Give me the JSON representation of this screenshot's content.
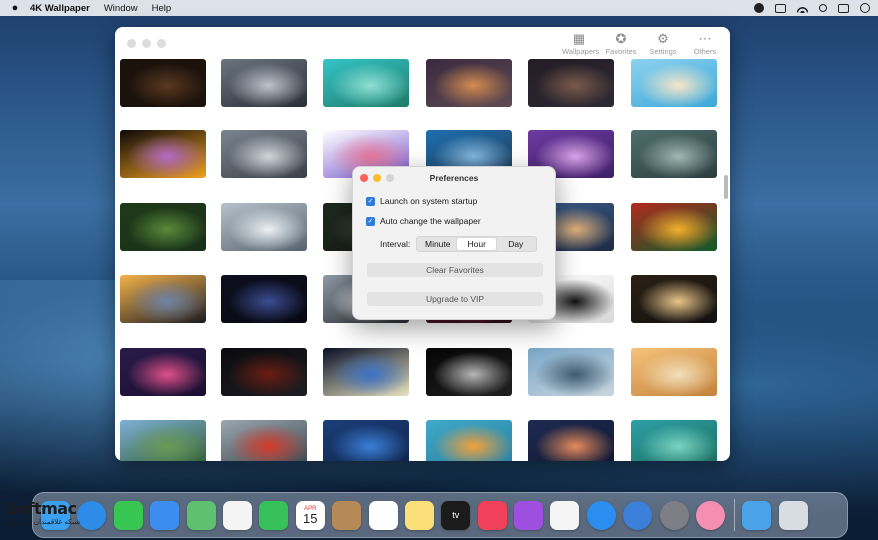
{
  "menubar": {
    "apple": "",
    "app_name": "4K Wallpaper",
    "menus": [
      "Window",
      "Help"
    ]
  },
  "toolbar": {
    "wallpapers": "Wallpapers",
    "favorites": "Favorites",
    "settings": "Settings",
    "others": "Others"
  },
  "wallpapers": [
    {
      "id": "coffee",
      "colors": [
        "#1b120c",
        "#5a3820",
        "#1b120c"
      ]
    },
    {
      "id": "car-silver",
      "colors": [
        "#6b7480",
        "#bcc4cc",
        "#2a2f36"
      ]
    },
    {
      "id": "rock-sea",
      "colors": [
        "#35c4c7",
        "#8fe0d5",
        "#1e7c6a"
      ]
    },
    {
      "id": "pier-sunset",
      "colors": [
        "#3a2a3f",
        "#d48b4f",
        "#5d4a52"
      ]
    },
    {
      "id": "city-aerial",
      "colors": [
        "#231c24",
        "#7a5a4a",
        "#2c2a36"
      ]
    },
    {
      "id": "flamingo-beach",
      "colors": [
        "#8ed2f0",
        "#f7e6c8",
        "#3ba8d8"
      ]
    },
    {
      "id": "butterfly-flowers",
      "colors": [
        "#0c0908",
        "#b36ac4",
        "#f0a020"
      ]
    },
    {
      "id": "car-dark",
      "colors": [
        "#7b8590",
        "#cfd6dc",
        "#3a3f46"
      ]
    },
    {
      "id": "colorful-cat",
      "colors": [
        "#ffffff",
        "#e8789c",
        "#7a5ad0"
      ]
    },
    {
      "id": "harbor",
      "colors": [
        "#1e6fb0",
        "#84b8df",
        "#223b56"
      ]
    },
    {
      "id": "purple-flowers",
      "colors": [
        "#6d3aa0",
        "#d8a2e6",
        "#3e1f66"
      ]
    },
    {
      "id": "wet-leaf",
      "colors": [
        "#4e6e6c",
        "#a0b7b2",
        "#2b3d3d"
      ]
    },
    {
      "id": "winding-road",
      "colors": [
        "#1f3a18",
        "#5a8a3a",
        "#17301a"
      ]
    },
    {
      "id": "snow-jeep",
      "colors": [
        "#b5c2cc",
        "#ecf1f4",
        "#56636e"
      ]
    },
    {
      "id": "forest-mist",
      "colors": [
        "#1f2a1e",
        "#3d4c39",
        "#141c14"
      ]
    },
    {
      "id": "pref-hidden-1",
      "colors": [
        "#29465c",
        "#6a8aa2",
        "#1c2d3b"
      ]
    },
    {
      "id": "girl-stars",
      "colors": [
        "#3c5f8c",
        "#e0b07a",
        "#1c2a44"
      ]
    },
    {
      "id": "tropical-leaves",
      "colors": [
        "#b02a1c",
        "#f3b02c",
        "#0f5a2c"
      ]
    },
    {
      "id": "car-sunset",
      "colors": [
        "#f4b24a",
        "#6f84a6",
        "#1b1b22"
      ]
    },
    {
      "id": "concept-car",
      "colors": [
        "#0d0f1f",
        "#3c4d92",
        "#070812"
      ]
    },
    {
      "id": "motorbike",
      "colors": [
        "#8f9aa6",
        "#eaeff3",
        "#2e3238"
      ]
    },
    {
      "id": "pref-hidden-2",
      "colors": [
        "#7a1f3c",
        "#e05a7c",
        "#2b0b18"
      ]
    },
    {
      "id": "abstract-curve",
      "colors": [
        "#ffffff",
        "#111111",
        "#d8d8d8"
      ]
    },
    {
      "id": "supercar-light",
      "colors": [
        "#2b2014",
        "#e9c58a",
        "#111111"
      ]
    },
    {
      "id": "neon-city",
      "colors": [
        "#2a1a4a",
        "#e0508a",
        "#1a1030"
      ]
    },
    {
      "id": "car-red-4",
      "colors": [
        "#0b0b0e",
        "#6b1c12",
        "#1e1e22"
      ]
    },
    {
      "id": "planet-space",
      "colors": [
        "#0a0f26",
        "#3b72c6",
        "#e7e2c0"
      ]
    },
    {
      "id": "astronaut-helmet",
      "colors": [
        "#050505",
        "#b7b7b7",
        "#202020"
      ]
    },
    {
      "id": "coast-cliffs",
      "colors": [
        "#7aa6c8",
        "#3d5b6e",
        "#c9d6de"
      ]
    },
    {
      "id": "desert-car",
      "colors": [
        "#f6c27a",
        "#f2e0bc",
        "#c2823c"
      ]
    },
    {
      "id": "valley-lake",
      "colors": [
        "#7fb0d8",
        "#6a9a52",
        "#2c5a2a"
      ]
    },
    {
      "id": "red-car-mountain",
      "colors": [
        "#9aa7b0",
        "#d33b2a",
        "#39424a"
      ]
    },
    {
      "id": "blue-texture",
      "colors": [
        "#1a3f7a",
        "#3b7fd8",
        "#0f2448"
      ]
    },
    {
      "id": "autumn-leaves",
      "colors": [
        "#3fa9c9",
        "#f2a03a",
        "#2c7fa0"
      ]
    },
    {
      "id": "sunset-sky",
      "colors": [
        "#1e2a52",
        "#e58a5a",
        "#0f1630"
      ]
    },
    {
      "id": "lagoon-aerial",
      "colors": [
        "#2da0a8",
        "#7ad4c2",
        "#1c6b5a"
      ]
    }
  ],
  "preferences": {
    "title": "Preferences",
    "launch_label": "Launch on system startup",
    "launch_checked": true,
    "auto_label": "Auto change the wallpaper",
    "auto_checked": true,
    "interval_label": "Interval:",
    "interval_options": [
      "Minute",
      "Hour",
      "Day"
    ],
    "interval_selected": "Hour",
    "clear_favorites": "Clear Favorites",
    "upgrade": "Upgrade to VIP"
  },
  "dock": {
    "calendar_month": "APR",
    "calendar_day": "15",
    "tv_label": "tv",
    "apps": [
      {
        "name": "finder",
        "color": "#3aa0f0"
      },
      {
        "name": "safari",
        "color": "#2f8be8"
      },
      {
        "name": "messages",
        "color": "#38c653"
      },
      {
        "name": "mail",
        "color": "#3d8df0"
      },
      {
        "name": "maps",
        "color": "#5dc170"
      },
      {
        "name": "photos",
        "color": "#f4f4f4"
      },
      {
        "name": "facetime",
        "color": "#36c15a"
      },
      {
        "name": "calendar",
        "color": "#ffffff"
      },
      {
        "name": "contacts",
        "color": "#b58a56"
      },
      {
        "name": "reminders",
        "color": "#ffffff"
      },
      {
        "name": "notes",
        "color": "#fbe07a"
      },
      {
        "name": "tv",
        "color": "#1b1b1b"
      },
      {
        "name": "music",
        "color": "#f0405a"
      },
      {
        "name": "podcasts",
        "color": "#9f4fe0"
      },
      {
        "name": "news",
        "color": "#f5f5f5"
      },
      {
        "name": "app-store",
        "color": "#2c8df0"
      },
      {
        "name": "altstore",
        "color": "#3b7fd8"
      },
      {
        "name": "system-preferences",
        "color": "#7d7f84"
      },
      {
        "name": "4k-wallpaper",
        "color": "#f48fb1"
      },
      {
        "name": "downloads",
        "color": "#4aa3e8"
      },
      {
        "name": "trash",
        "color": "#d7dde3"
      }
    ]
  },
  "watermark": {
    "brand": "Softmac",
    "tagline": "شبکه علاقمندان اپل ایران"
  },
  "colors": {
    "accent": "#2e7bd9",
    "light_red": "#ff5f57",
    "light_yellow": "#febc2e",
    "light_gray": "#d4d4d4"
  }
}
